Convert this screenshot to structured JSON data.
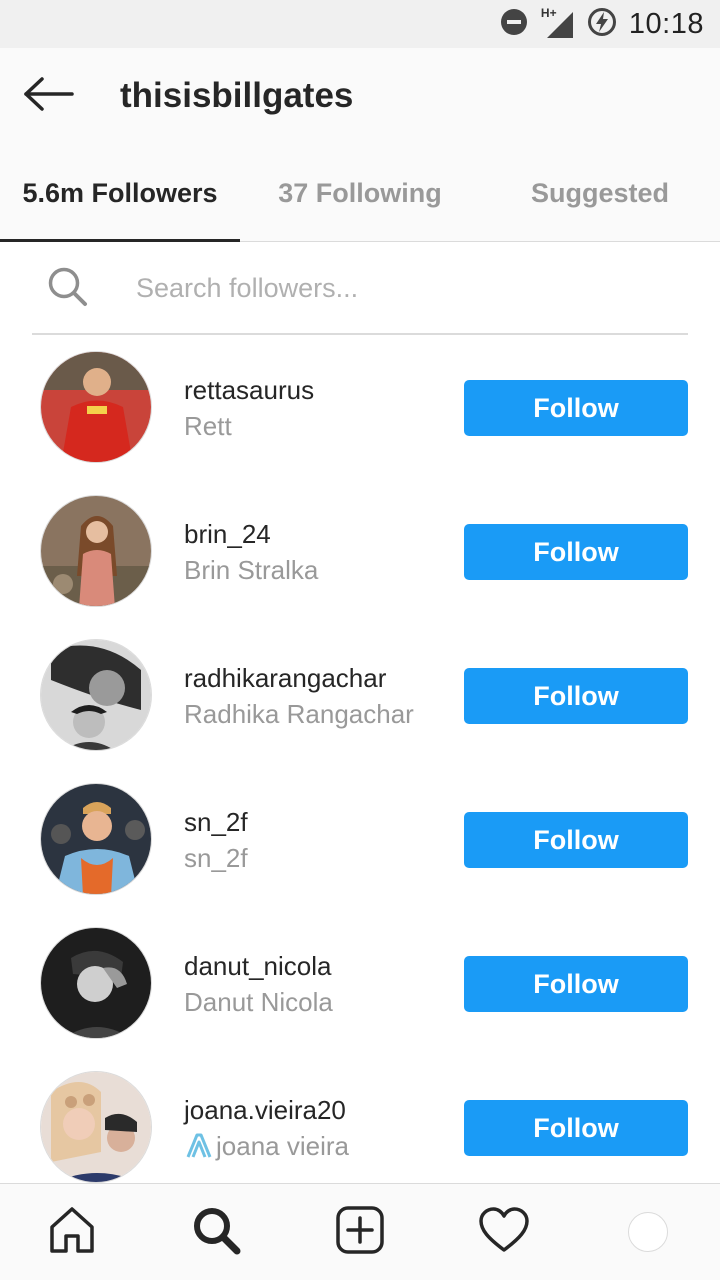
{
  "status_bar": {
    "time": "10:18",
    "network": "H+",
    "icons": [
      "do-not-disturb-icon",
      "signal-icon",
      "battery-charging-icon"
    ]
  },
  "header": {
    "title": "thisisbillgates",
    "back_icon": "arrow-left-icon"
  },
  "tabs": [
    {
      "label": "5.6m Followers",
      "active": true
    },
    {
      "label": "37 Following",
      "active": false
    },
    {
      "label": "Suggested",
      "active": false
    }
  ],
  "search": {
    "placeholder": "Search followers...",
    "value": ""
  },
  "followers": [
    {
      "username": "rettasaurus",
      "full_name": "Rett",
      "button": "Follow"
    },
    {
      "username": "brin_24",
      "full_name": "Brin Stralka",
      "button": "Follow"
    },
    {
      "username": "radhikarangachar",
      "full_name": "Radhika Rangachar",
      "button": "Follow"
    },
    {
      "username": "sn_2f",
      "full_name": "sn_2f",
      "button": "Follow"
    },
    {
      "username": "danut_nicola",
      "full_name": "Danut Nicola",
      "button": "Follow"
    },
    {
      "username": "joana.vieira20",
      "full_name": "joana vieira",
      "button": "Follow",
      "name_prefix_icon": "ribbon-icon"
    }
  ],
  "bottom_nav": [
    "home-icon",
    "search-icon",
    "add-post-icon",
    "heart-icon",
    "profile-avatar"
  ],
  "colors": {
    "follow_button": "#1a9bf6",
    "secondary_text": "#999999",
    "primary_text": "#262626"
  }
}
